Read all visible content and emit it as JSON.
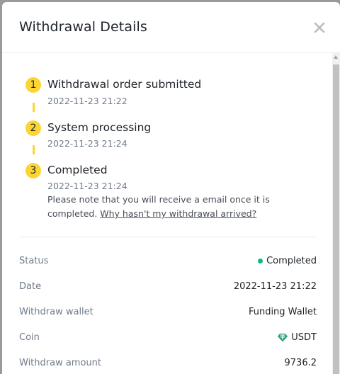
{
  "modal": {
    "title": "Withdrawal Details"
  },
  "steps": [
    {
      "number": "1",
      "title": "Withdrawal order submitted",
      "time": "2022-11-23 21:22"
    },
    {
      "number": "2",
      "title": "System processing",
      "time": "2022-11-23 21:24"
    },
    {
      "number": "3",
      "title": "Completed",
      "time": "2022-11-23 21:24",
      "note_prefix": "Please note that you will receive a email once it is completed. ",
      "note_link": "Why hasn't my withdrawal arrived?"
    }
  ],
  "details": {
    "status": {
      "label": "Status",
      "value": "Completed"
    },
    "date": {
      "label": "Date",
      "value": "2022-11-23 21:22"
    },
    "wallet": {
      "label": "Withdraw wallet",
      "value": "Funding Wallet"
    },
    "coin": {
      "label": "Coin",
      "value": "USDT"
    },
    "amount": {
      "label": "Withdraw amount",
      "value": "9736.2"
    }
  },
  "colors": {
    "accent": "#fcd535",
    "success": "#02c076",
    "coin": "#26a17b"
  },
  "icons": {
    "close": "close-icon",
    "coin": "usdt-coin-icon",
    "status": "status-dot-icon"
  }
}
